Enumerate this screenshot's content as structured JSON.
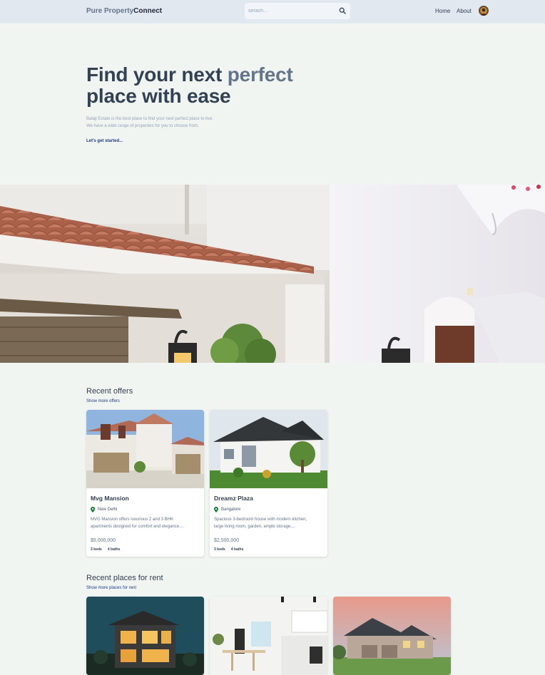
{
  "header": {
    "logo_part1": "Pure Property",
    "logo_part2": "Connect",
    "search_placeholder": "serach...",
    "search_icon": "search-icon",
    "nav": [
      {
        "label": "Home"
      },
      {
        "label": "About"
      }
    ],
    "avatar": "user-avatar"
  },
  "hero": {
    "title_line1_a": "Find your next ",
    "title_line1_b": "perfect",
    "title_line2": "place with ease",
    "desc_line1": "Balaji Estate is the best place to find your next perfect place to live.",
    "desc_line2": "We have a wide range of properties for you to choose from.",
    "cta": "Let's get started..."
  },
  "offers": {
    "title": "Recent offers",
    "link": "Show more offers",
    "items": [
      {
        "name": "Mvg Mansion",
        "location": "New Delhi",
        "desc_line1": "MVG Mansion offers luxurious 2 and 3 BHK",
        "desc_line2": "apartments designed for comfort and elegance....",
        "price": "$5,000,000",
        "beds": "3 beds",
        "baths": "4 baths"
      },
      {
        "name": "Dreamz Plaza",
        "location": "Bangalore",
        "desc_line1": "Spacious 3-bedroom house with modern kitchen,",
        "desc_line2": "large living room, garden, ample storage,...",
        "price": "$2,500,000",
        "beds": "3 beds",
        "baths": "4 baths"
      }
    ]
  },
  "rent": {
    "title": "Recent places for rent",
    "link": "Show more places for rent"
  },
  "colors": {
    "background": "#f1f5f1",
    "header": "#e2e8f0",
    "accent": "#64748b",
    "link": "#1e3a8a",
    "pin": "#15803d"
  }
}
